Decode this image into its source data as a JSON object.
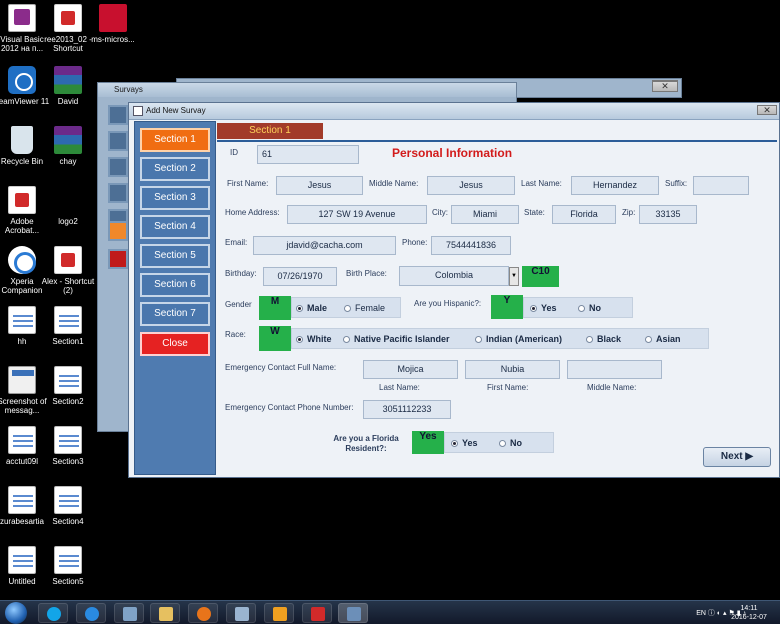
{
  "desktop": {
    "icons": [
      {
        "label": "Visual Basic 2012 на п...",
        "kind": "vb"
      },
      {
        "label": "ree2013_02 - Shortcut",
        "kind": "pdf"
      },
      {
        "label": "ms-micros...",
        "kind": "red"
      },
      {
        "label": "TeamViewer 11",
        "kind": "tv"
      },
      {
        "label": "David",
        "kind": "rar"
      },
      {
        "label": "Recycle Bin",
        "kind": "bin"
      },
      {
        "label": "chay",
        "kind": "rar"
      },
      {
        "label": "Adobe Acrobat...",
        "kind": "pdf"
      },
      {
        "label": "logo2",
        "kind": "none"
      },
      {
        "label": "Xperia Companion",
        "kind": "xp"
      },
      {
        "label": "Alex - Shortcut (2)",
        "kind": "pdf"
      },
      {
        "label": "hh",
        "kind": "doc"
      },
      {
        "label": "Section1",
        "kind": "doc"
      },
      {
        "label": "Screenshot of messag...",
        "kind": "shot"
      },
      {
        "label": "Section2",
        "kind": "doc"
      },
      {
        "label": "acctut09l",
        "kind": "doc"
      },
      {
        "label": "Section3",
        "kind": "doc"
      },
      {
        "label": "zurabesartia",
        "kind": "doc"
      },
      {
        "label": "Section4",
        "kind": "doc"
      },
      {
        "label": "Untitled",
        "kind": "doc"
      },
      {
        "label": "Section5",
        "kind": "doc"
      }
    ]
  },
  "back_window": {
    "title": "Survays"
  },
  "form": {
    "window_title": "Add New Survay",
    "nav": [
      "Section 1",
      "Section 2",
      "Section 3",
      "Section 4",
      "Section 5",
      "Section 6",
      "Section 7",
      "Close"
    ],
    "active_nav": "Section 1",
    "tab_label": "Section 1",
    "header": "Personal Information",
    "id": {
      "label": "ID",
      "value": "61"
    },
    "first_name": {
      "label": "First Name:",
      "value": "Jesus"
    },
    "middle_name": {
      "label": "Middle Name:",
      "value": "Jesus"
    },
    "last_name": {
      "label": "Last Name:",
      "value": "Hernandez"
    },
    "suffix": {
      "label": "Suffix:",
      "value": ""
    },
    "home_address": {
      "label": "Home Address:",
      "value": "127 SW 19 Avenue"
    },
    "city": {
      "label": "City:",
      "value": "Miami"
    },
    "state": {
      "label": "State:",
      "value": "Florida"
    },
    "zip": {
      "label": "Zip:",
      "value": "33135"
    },
    "email": {
      "label": "Email:",
      "value": "jdavid@cacha.com"
    },
    "phone": {
      "label": "Phone:",
      "value": "7544441836"
    },
    "birthday": {
      "label": "Birthday:",
      "value": "07/26/1970"
    },
    "birth_place": {
      "label": "Birth Place:",
      "value": "Colombia",
      "code": "C10"
    },
    "gender": {
      "label": "Gender",
      "code": "M",
      "options": [
        "Male",
        "Female"
      ],
      "selected": "Male"
    },
    "hispanic": {
      "label": "Are you Hispanic?:",
      "code": "Y",
      "options": [
        "Yes",
        "No"
      ],
      "selected": "Yes"
    },
    "race": {
      "label": "Race:",
      "code": "W",
      "options": [
        "White",
        "Native Pacific Islander",
        "Indian (American)",
        "Black",
        "Asian"
      ],
      "selected": "White"
    },
    "emergency_contact": {
      "label": "Emergency Contact Full Name:",
      "last_name": "Mojica",
      "first_name": "Nubia",
      "middle_name": "",
      "last_label": "Last Name:",
      "first_label": "First Name:",
      "middle_label": "Middle Name:"
    },
    "emergency_phone": {
      "label": "Emergency Contact Phone Number:",
      "value": "3051112233"
    },
    "florida": {
      "label": "Are you a Florida Resident?:",
      "code": "Yes",
      "options": [
        "Yes",
        "No"
      ],
      "selected": "Yes"
    },
    "next_label": "Next"
  },
  "taskbar": {
    "language": "EN",
    "time": "14:11",
    "date": "2016-12-07"
  },
  "colors": {
    "active_section": "#f06d12",
    "close_button": "#e52222",
    "code_box": "#25b04a",
    "header": "#d21b1b"
  }
}
